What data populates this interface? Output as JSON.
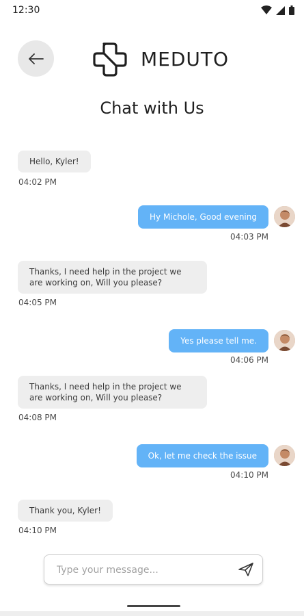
{
  "status": {
    "time": "12:30"
  },
  "header": {
    "brand": "MEDUTO",
    "title": "Chat with Us"
  },
  "messages": [
    {
      "side": "in",
      "text": "Hello, Kyler!",
      "time": "04:02 PM"
    },
    {
      "side": "out",
      "text": "Hy Michole, Good evening",
      "time": "04:03 PM"
    },
    {
      "side": "in",
      "text": "Thanks, I need help in the project we are working on, Will you please?",
      "time": "04:05 PM"
    },
    {
      "side": "out",
      "text": "Yes please tell me.",
      "time": "04:06 PM"
    },
    {
      "side": "in",
      "text": "Thanks, I need help in the project we are working on, Will you please?",
      "time": "04:08 PM"
    },
    {
      "side": "out",
      "text": "Ok, let me check the issue",
      "time": "04:10 PM"
    },
    {
      "side": "in",
      "text": "Thank you, Kyler!",
      "time": "04:10 PM"
    }
  ],
  "composer": {
    "placeholder": "Type your message...",
    "value": ""
  },
  "icons": {
    "back": "arrow-left-icon",
    "send": "send-icon",
    "logo": "meduto-logo"
  },
  "colors": {
    "outgoing_bubble": "#63b3f7",
    "incoming_bubble": "#eeeeee",
    "back_button": "#e8e8e8"
  }
}
